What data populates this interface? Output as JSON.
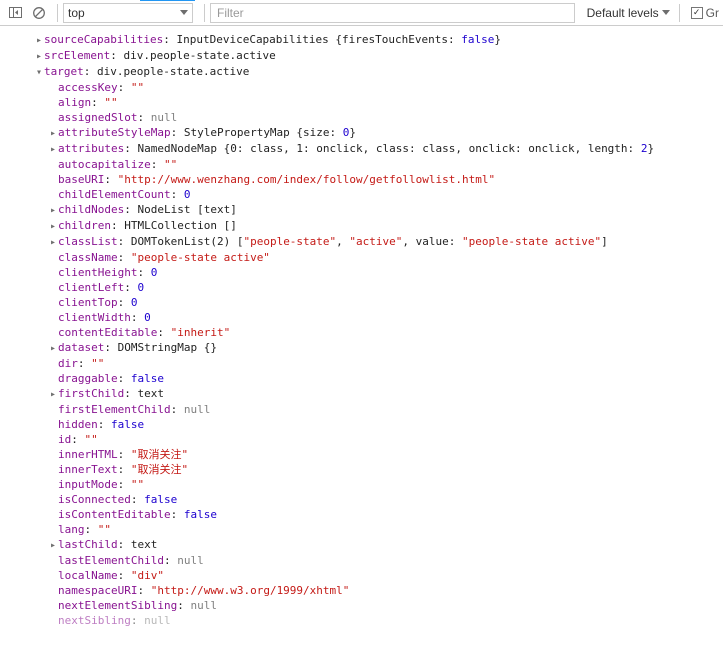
{
  "toolbar": {
    "context_selector": "top",
    "filter_placeholder": "Filter",
    "levels_label": "Default levels",
    "group_label": "Gr"
  },
  "props": {
    "sourceCapabilities": {
      "label": "sourceCapabilities",
      "desc": "InputDeviceCapabilities {firesTouchEvents: ",
      "tail": "}",
      "bool": "false"
    },
    "srcElement": {
      "label": "srcElement",
      "desc": "div.people-state.active"
    },
    "target": {
      "label": "target",
      "desc": "div.people-state.active"
    },
    "accessKey": {
      "label": "accessKey",
      "str": "\"\""
    },
    "align": {
      "label": "align",
      "str": "\"\""
    },
    "assignedSlot": {
      "label": "assignedSlot",
      "null": "null"
    },
    "attributeStyleMap": {
      "label": "attributeStyleMap",
      "desc": "StylePropertyMap {size: ",
      "num": "0",
      "tail": "}"
    },
    "attributes": {
      "label": "attributes",
      "desc": "NamedNodeMap {0: class, 1: onclick, class: class, onclick: onclick, length: ",
      "num": "2",
      "tail": "}"
    },
    "autocapitalize": {
      "label": "autocapitalize",
      "str": "\"\""
    },
    "baseURI": {
      "label": "baseURI",
      "str": "\"http://www.wenzhang.com/index/follow/getfollowlist.html\""
    },
    "childElementCount": {
      "label": "childElementCount",
      "num": "0"
    },
    "childNodes": {
      "label": "childNodes",
      "desc": "NodeList [text]"
    },
    "children": {
      "label": "children",
      "desc": "HTMLCollection []"
    },
    "classList": {
      "label": "classList",
      "desc1": "DOMTokenList(2) [",
      "s1": "\"people-state\"",
      "c": ", ",
      "s2": "\"active\"",
      "mid": ", value: ",
      "s3": "\"people-state active\"",
      "tail": "]"
    },
    "className": {
      "label": "className",
      "str": "\"people-state active\""
    },
    "clientHeight": {
      "label": "clientHeight",
      "num": "0"
    },
    "clientLeft": {
      "label": "clientLeft",
      "num": "0"
    },
    "clientTop": {
      "label": "clientTop",
      "num": "0"
    },
    "clientWidth": {
      "label": "clientWidth",
      "num": "0"
    },
    "contentEditable": {
      "label": "contentEditable",
      "str": "\"inherit\""
    },
    "dataset": {
      "label": "dataset",
      "desc": "DOMStringMap {}"
    },
    "dir": {
      "label": "dir",
      "str": "\"\""
    },
    "draggable": {
      "label": "draggable",
      "bool": "false"
    },
    "firstChild": {
      "label": "firstChild",
      "desc": "text"
    },
    "firstElementChild": {
      "label": "firstElementChild",
      "null": "null"
    },
    "hidden": {
      "label": "hidden",
      "bool": "false"
    },
    "id": {
      "label": "id",
      "str": "\"\""
    },
    "innerHTML": {
      "label": "innerHTML",
      "str": "\"取消关注\""
    },
    "innerText": {
      "label": "innerText",
      "str": "\"取消关注\""
    },
    "inputMode": {
      "label": "inputMode",
      "str": "\"\""
    },
    "isConnected": {
      "label": "isConnected",
      "bool": "false"
    },
    "isContentEditable": {
      "label": "isContentEditable",
      "bool": "false"
    },
    "lang": {
      "label": "lang",
      "str": "\"\""
    },
    "lastChild": {
      "label": "lastChild",
      "desc": "text"
    },
    "lastElementChild": {
      "label": "lastElementChild",
      "null": "null"
    },
    "localName": {
      "label": "localName",
      "str": "\"div\""
    },
    "namespaceURI": {
      "label": "namespaceURI",
      "str": "\"http://www.w3.org/1999/xhtml\""
    },
    "nextElementSibling": {
      "label": "nextElementSibling",
      "null": "null"
    },
    "nextSibling": {
      "label": "nextSibling",
      "null": "null"
    }
  }
}
